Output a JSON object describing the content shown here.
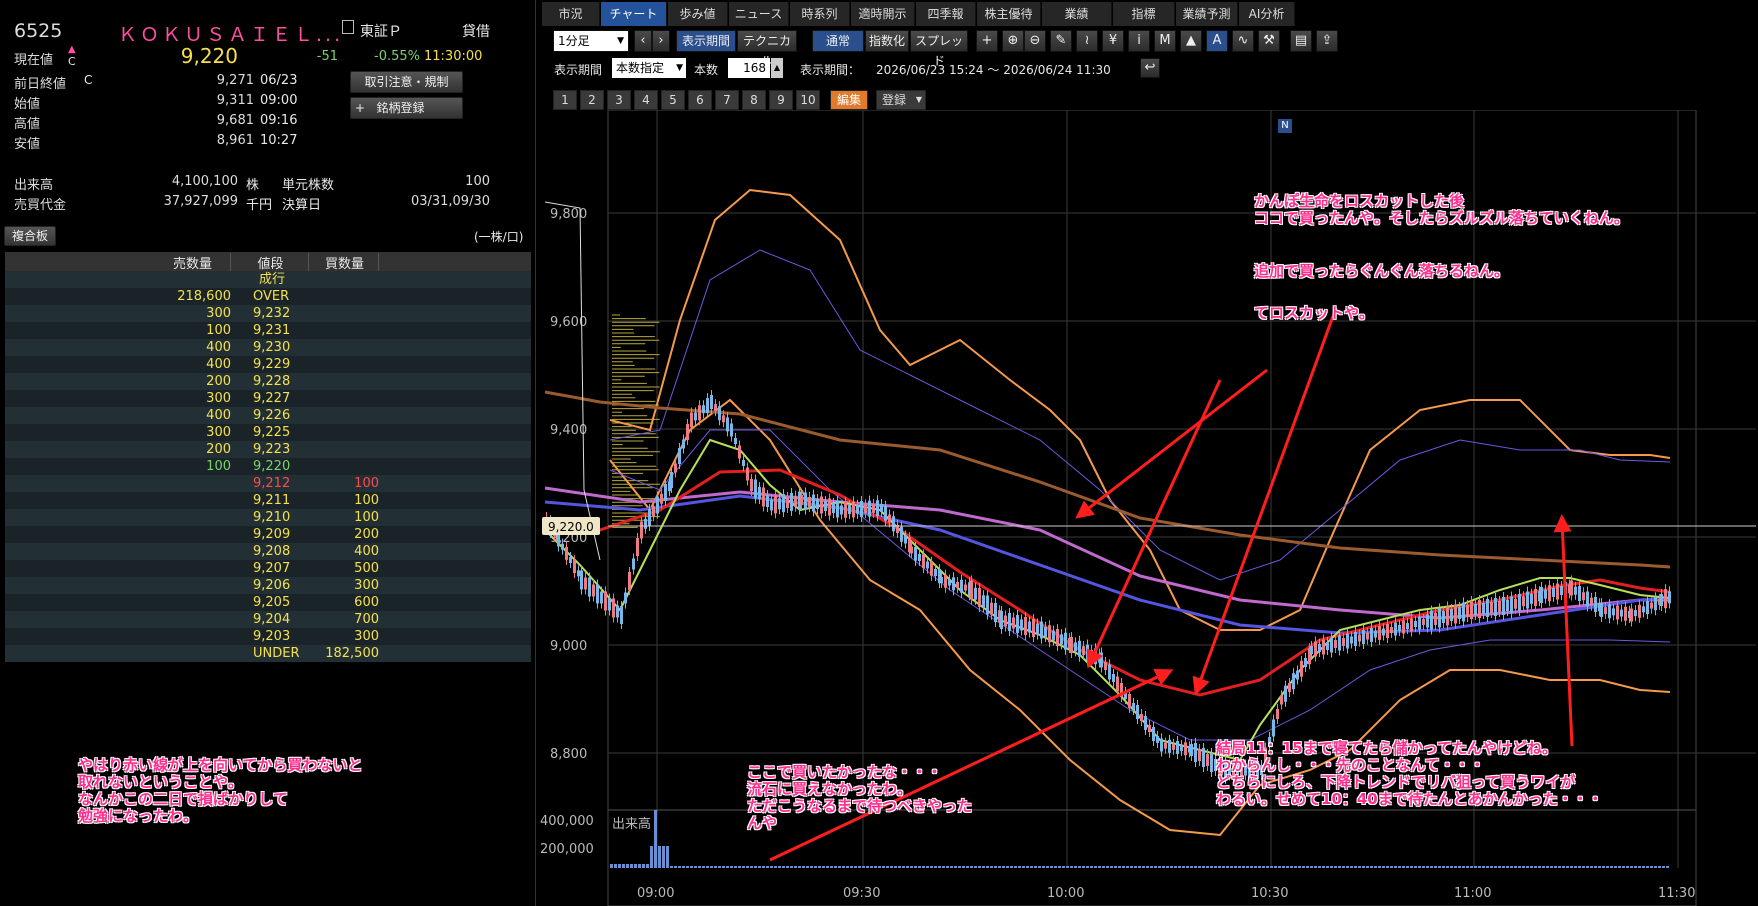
{
  "stock": {
    "code": "6525",
    "name": "ＫＯＫＵＳＡＩＥＬ...",
    "market": "東証Ｐ",
    "loan": "貸借",
    "current_label": "現在値",
    "current_mark": "C",
    "current": "9,220",
    "change": "-51",
    "change_pct": "-0.55%",
    "current_time": "11:30:00",
    "prev_label": "前日終値",
    "prev_mark": "C",
    "prev": "9,271",
    "prev_date": "06/23",
    "open_label": "始値",
    "open": "9,311",
    "open_time": "09:00",
    "high_label": "高値",
    "high": "9,681",
    "high_time": "09:16",
    "low_label": "安値",
    "low": "8,961",
    "low_time": "10:27",
    "volume_label": "出来高",
    "volume": "4,100,100",
    "volume_unit": "株",
    "unit_label": "単元株数",
    "unit": "100",
    "turnover_label": "売買代金",
    "turnover": "37,927,099",
    "turnover_unit": "千円",
    "settle_label": "決算日",
    "settle": "03/31,09/30"
  },
  "buttons": {
    "caution": "取引注意・規制",
    "register": "銘柄登録",
    "register_plus": "+",
    "combined": "複合板",
    "per_share": "(一株/口)"
  },
  "board": {
    "headers": [
      "売数量",
      "値段",
      "買数量"
    ],
    "rows": [
      {
        "sell": "",
        "price": "成行",
        "buy": ""
      },
      {
        "sell": "218,600",
        "price": "OVER",
        "buy": ""
      },
      {
        "sell": "300",
        "price": "9,232",
        "buy": ""
      },
      {
        "sell": "100",
        "price": "9,231",
        "buy": ""
      },
      {
        "sell": "400",
        "price": "9,230",
        "buy": ""
      },
      {
        "sell": "400",
        "price": "9,229",
        "buy": ""
      },
      {
        "sell": "200",
        "price": "9,228",
        "buy": ""
      },
      {
        "sell": "300",
        "price": "9,227",
        "buy": ""
      },
      {
        "sell": "400",
        "price": "9,226",
        "buy": ""
      },
      {
        "sell": "300",
        "price": "9,225",
        "buy": ""
      },
      {
        "sell": "200",
        "price": "9,223",
        "buy": ""
      },
      {
        "sell": "100",
        "price": "9,220",
        "buy": ""
      },
      {
        "sell": "",
        "price": "9,212",
        "buy": "100"
      },
      {
        "sell": "",
        "price": "9,211",
        "buy": "100"
      },
      {
        "sell": "",
        "price": "9,210",
        "buy": "100"
      },
      {
        "sell": "",
        "price": "9,209",
        "buy": "200"
      },
      {
        "sell": "",
        "price": "9,208",
        "buy": "400"
      },
      {
        "sell": "",
        "price": "9,207",
        "buy": "500"
      },
      {
        "sell": "",
        "price": "9,206",
        "buy": "300"
      },
      {
        "sell": "",
        "price": "9,205",
        "buy": "600"
      },
      {
        "sell": "",
        "price": "9,204",
        "buy": "700"
      },
      {
        "sell": "",
        "price": "9,203",
        "buy": "300"
      },
      {
        "sell": "",
        "price": "UNDER",
        "buy": "182,500"
      }
    ]
  },
  "tabs": [
    "市況",
    "チャート",
    "歩み値",
    "ニュース",
    "時系列",
    "適時開示",
    "四季報",
    "株主優待",
    "業績",
    "指標",
    "業績予測",
    "AI分析"
  ],
  "toolbar": {
    "interval": "1分足",
    "period": "表示期間",
    "technical": "テクニカル",
    "normal": "通常",
    "index": "指数化",
    "spread": "スプレッド"
  },
  "period_row": {
    "label": "表示期間",
    "mode": "本数指定",
    "count_label": "本数",
    "count": "168",
    "range_label": "表示期間：",
    "range": "2026/06/23 15:24 ～ 2026/06/24 11:30"
  },
  "num_buttons": [
    "1",
    "2",
    "3",
    "4",
    "5",
    "6",
    "7",
    "8",
    "9",
    "10"
  ],
  "edit": "編集",
  "register_menu": "登録",
  "chart": {
    "yticks": [
      "9,800",
      "9,600",
      "9,400",
      "9,200",
      "9,000",
      "8,800"
    ],
    "xticks": [
      "09:00",
      "09:30",
      "10:00",
      "10:30",
      "11:00",
      "11:30"
    ],
    "price_tag": "9,220.0",
    "vol_ticks": [
      "400,000",
      "200,000"
    ],
    "vol_label": "出来高",
    "n_marker": "N"
  },
  "annotations": {
    "a1": "かんぽ生命をロスカットした後\nココで買ったんや。そしたらズルズル落ちていくねん。",
    "a2": "追加で買ったらぐんぐん落ちるねん。",
    "a3": "てロスカットや。",
    "a4": "ここで買いたかったな・・・\n流石に買えなかったわ。\nただこうなるまで待つべきやった\nんや",
    "a5": "結局11：15まで寝てたら儲かってたんやけどね。\nわからんし・・・先のことなんて・・・\nどちらにしろ、下降トレンドでリバ狙って買うワイが\nわるい。せめて10：40まで待たんとあかんかった・・・",
    "a6": "やはり赤い線が上を向いてから買わないと\n取れないということや。\nなんかこの二日で損ばかりして\n勉強になったわ。"
  },
  "colors": {
    "accent": "#25539b",
    "up": "#f07a84",
    "down": "#7ab8ea",
    "pink": "#ff2d8c",
    "yellow": "#f4e04d",
    "green": "#7bd36b",
    "red": "#ff3b3b"
  }
}
